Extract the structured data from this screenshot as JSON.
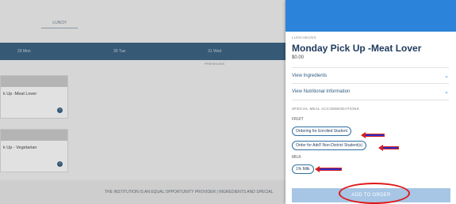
{
  "background": {
    "tab_label": "LUNCH",
    "days": [
      "29 Mon",
      "30 Tue",
      "31 Wed"
    ],
    "subday_label": "PREMIUMS",
    "cards": [
      {
        "title": "k Up -Meat Lover"
      },
      {
        "title": "k Up - Vegetarian"
      }
    ],
    "footer_text": "THE INSTITUTION IS AN EQUAL OPPORTUNITY PROVIDER  |  INGREDIENTS AND SPECIAL"
  },
  "panel": {
    "category": "LUNCHEONS",
    "title": "Monday Pick Up -Meat Lover",
    "price": "$0.00",
    "accordions": [
      {
        "label": "View Ingredients"
      },
      {
        "label": "View Nutritional Information"
      }
    ],
    "section_label": "SPECIAL MEAL ACCOMMODATIONS",
    "groups": [
      {
        "label": "FRUIT",
        "options": [
          "Ordering for Enrolled Student",
          "Order for Add'l Non-District Student(s)"
        ]
      },
      {
        "label": "MILK",
        "options": [
          "1% Milk"
        ]
      }
    ],
    "add_button_label": "ADD TO ORDER"
  },
  "colors": {
    "panel_header": "#2b84d9",
    "add_button": "#a7c5e5",
    "annotation_red": "#d81e1e",
    "annotation_blue": "#2a31c9"
  },
  "icons": [
    "chevron-down-icon",
    "arrow-right-circle-icon"
  ]
}
